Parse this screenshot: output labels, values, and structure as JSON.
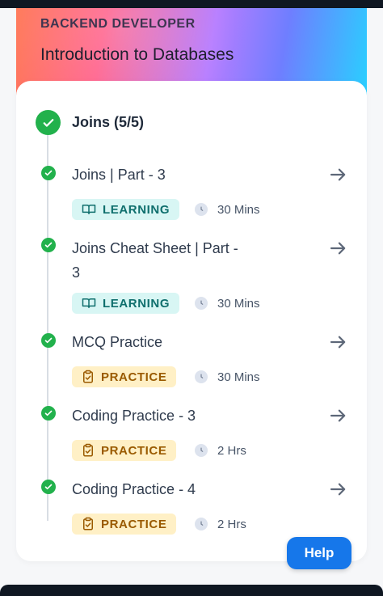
{
  "header": {
    "track_label": "BACKEND DEVELOPER",
    "course_title": "Introduction to Databases"
  },
  "section": {
    "title": "Joins (5/5)",
    "status_icon": "check-circle-icon"
  },
  "items": [
    {
      "title": "Joins | Part - 3",
      "tag": "LEARNING",
      "tag_icon": "book-icon",
      "duration": "30 Mins"
    },
    {
      "title": "Joins Cheat Sheet | Part - 3",
      "tag": "LEARNING",
      "tag_icon": "book-icon",
      "duration": "30 Mins"
    },
    {
      "title": "MCQ Practice",
      "tag": "PRACTICE",
      "tag_icon": "clipboard-check-icon",
      "duration": "30 Mins"
    },
    {
      "title": "Coding Practice - 3",
      "tag": "PRACTICE",
      "tag_icon": "clipboard-check-icon",
      "duration": "2 Hrs"
    },
    {
      "title": "Coding Practice - 4",
      "tag": "PRACTICE",
      "tag_icon": "clipboard-check-icon",
      "duration": "2 Hrs"
    }
  ],
  "help_button": {
    "label": "Help"
  },
  "colors": {
    "success": "#22b14c",
    "learning_bg": "#d8f6f4",
    "learning_text": "#0f6f6d",
    "practice_bg": "#fff0c6",
    "practice_text": "#9a5a00",
    "help_bg": "#1677ea"
  }
}
